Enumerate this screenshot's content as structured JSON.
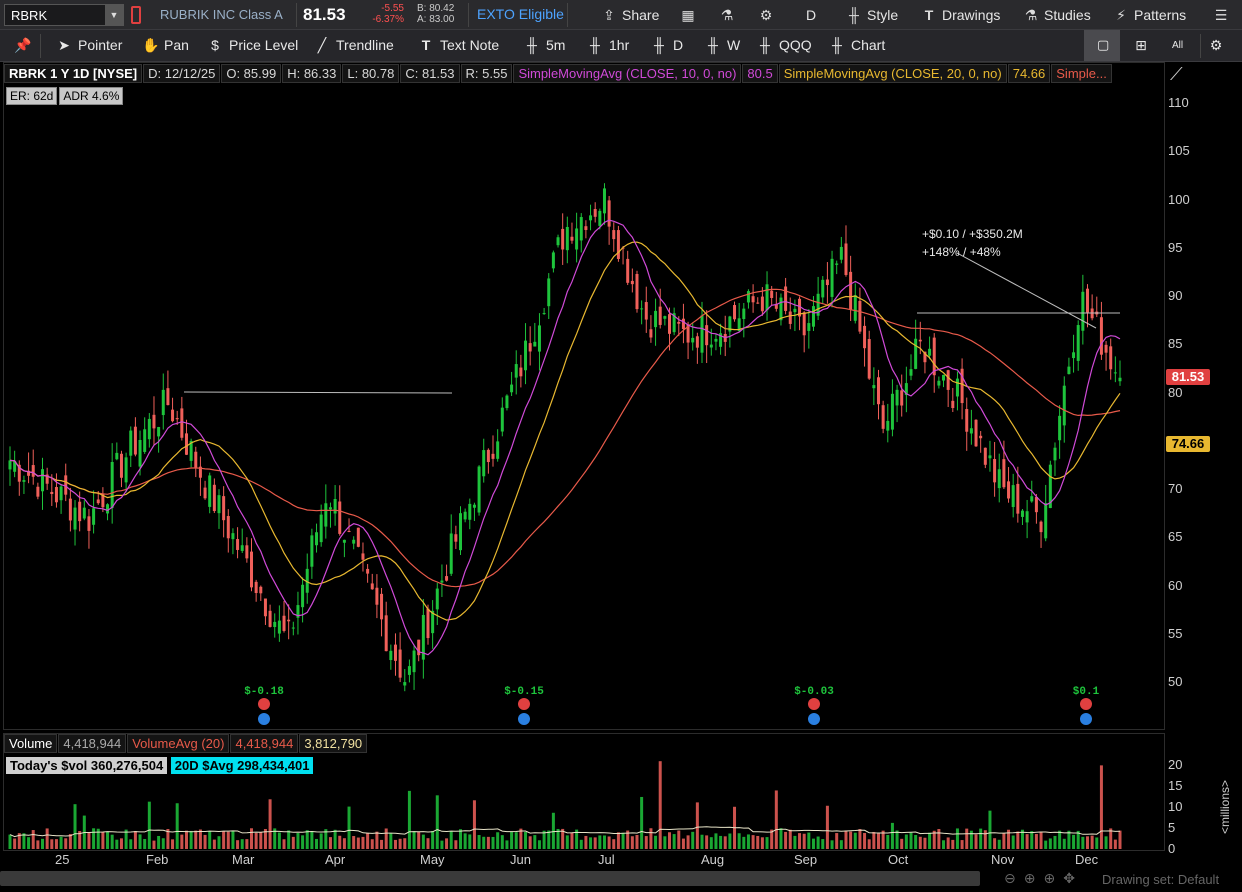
{
  "header": {
    "symbol": "RBRK",
    "company": "RUBRIK INC Class A",
    "last": "81.53",
    "change": "-5.55",
    "change_pct": "-6.37%",
    "bid": "B: 80.42",
    "ask": "A: 83.00",
    "exto": "EXTO Eligible",
    "share": "Share",
    "period": "D",
    "style": "Style",
    "drawings": "Drawings",
    "studies": "Studies",
    "patterns": "Patterns"
  },
  "toolbar": {
    "pointer": "Pointer",
    "pan": "Pan",
    "price_level": "Price Level",
    "trendline": "Trendline",
    "text_note": "Text Note",
    "t5m": "5m",
    "t1hr": "1hr",
    "tD": "D",
    "tW": "W",
    "qqq": "QQQ",
    "chart": "Chart",
    "all": "All"
  },
  "info": {
    "title": "RBRK 1 Y 1D [NYSE]",
    "date": "D: 12/12/25",
    "open": "O: 85.99",
    "high": "H: 86.33",
    "low": "L: 80.78",
    "close": "C: 81.53",
    "range": "R: 5.55",
    "sma10": "SimpleMovingAvg (CLOSE, 10, 0, no)",
    "sma10_val": "80.5",
    "sma20": "SimpleMovingAvg (CLOSE, 20, 0, no)",
    "sma20_val": "74.66",
    "sma_more": "Simple...",
    "er": "ER: 62d",
    "adr": "ADR 4.6%"
  },
  "volume_info": {
    "label": "Volume",
    "value": "4,418,944",
    "avg_label": "VolumeAvg (20)",
    "avg_value": "4,418,944",
    "avg_value2": "3,812,790",
    "today_dollar_vol": "Today's $vol 360,276,504",
    "avg_dollar_vol": "20D $Avg 298,434,401"
  },
  "annotation": {
    "line1": "+$0.10 / +$350.2M",
    "line2": "+148% / +48%"
  },
  "earnings": [
    "$-0.18",
    "$-0.15",
    "$-0.03",
    "$0.1"
  ],
  "price_ticks": [
    "110",
    "105",
    "100",
    "95",
    "90",
    "85",
    "80",
    "75",
    "70",
    "65",
    "60",
    "55",
    "50"
  ],
  "price_tag_close": "81.53",
  "price_tag_sma": "74.66",
  "volume_ticks": [
    "20",
    "15",
    "10",
    "5",
    "0"
  ],
  "volume_unit": "<millions>",
  "months": [
    "25",
    "Feb",
    "Mar",
    "Apr",
    "May",
    "Jun",
    "Jul",
    "Aug",
    "Sep",
    "Oct",
    "Nov",
    "Dec"
  ],
  "drawing_set": "Drawing set: Default",
  "colors": {
    "up": "#1ec43c",
    "down": "#f0605a",
    "sma10": "#d04ad8",
    "sma20": "#e8b830",
    "sma50": "#e85a4a",
    "accent": "#4da3ff"
  },
  "chart_data": {
    "type": "candlestick",
    "price_range": [
      45,
      112
    ],
    "volume_range": [
      0,
      22
    ],
    "x_labels": [
      "25",
      "Feb",
      "Mar",
      "Apr",
      "May",
      "Jun",
      "Jul",
      "Aug",
      "Sep",
      "Oct",
      "Nov",
      "Dec"
    ],
    "close_path": [
      [
        "25",
        73
      ],
      [
        "Jan-mid",
        70
      ],
      [
        "Jan-late",
        67
      ],
      [
        "Feb",
        74
      ],
      [
        "Feb-mid",
        79
      ],
      [
        "Feb-late",
        70
      ],
      [
        "Mar",
        62
      ],
      [
        "Mar-mid",
        54
      ],
      [
        "Mar-late",
        70
      ],
      [
        "Apr",
        60
      ],
      [
        "Apr-mid",
        50
      ],
      [
        "Apr-late",
        62
      ],
      [
        "May",
        73
      ],
      [
        "May-mid",
        84
      ],
      [
        "May-late",
        97
      ],
      [
        "Jun",
        100
      ],
      [
        "Jun-mid",
        88
      ],
      [
        "Jul",
        86
      ],
      [
        "Jul-mid",
        87
      ],
      [
        "Aug",
        90
      ],
      [
        "Aug-mid",
        86
      ],
      [
        "Sep",
        94
      ],
      [
        "Sep-mid",
        76
      ],
      [
        "Oct",
        85
      ],
      [
        "Oct-mid",
        79
      ],
      [
        "Nov",
        70
      ],
      [
        "Nov-mid",
        67
      ],
      [
        "Dec",
        90
      ],
      [
        "Dec-12",
        81.53
      ]
    ],
    "sma": [
      {
        "name": "SimpleMovingAvg (CLOSE, 10, 0, no)",
        "last": 80.5
      },
      {
        "name": "SimpleMovingAvg (CLOSE, 20, 0, no)",
        "last": 74.66
      },
      {
        "name": "Simple...",
        "last": 76
      }
    ],
    "volume_last_millions": 4.4
  }
}
